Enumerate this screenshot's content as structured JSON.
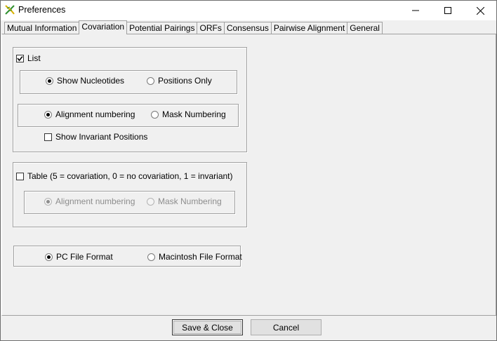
{
  "window": {
    "title": "Preferences"
  },
  "tabs": [
    {
      "label": "Mutual Information"
    },
    {
      "label": "Covariation",
      "active": true
    },
    {
      "label": "Potential Pairings"
    },
    {
      "label": "ORFs"
    },
    {
      "label": "Consensus"
    },
    {
      "label": "Pairwise Alignment"
    },
    {
      "label": "General"
    }
  ],
  "list_group": {
    "list_label": "List",
    "list_checked": true,
    "show_nucleotides": "Show Nucleotides",
    "positions_only": "Positions Only",
    "alignment_numbering": "Alignment numbering",
    "mask_numbering": "Mask Numbering",
    "show_invariant": "Show Invariant Positions"
  },
  "table_group": {
    "table_label": "Table (5 = covariation, 0 = no covariation, 1 = invariant)",
    "alignment_numbering": "Alignment numbering",
    "mask_numbering": "Mask Numbering"
  },
  "format_group": {
    "pc_format": "PC File Format",
    "mac_format": "Macintosh File Format"
  },
  "buttons": {
    "save_close": "Save & Close",
    "cancel": "Cancel"
  },
  "icons": {
    "app": "dna-icon",
    "minimize": "minimize-icon",
    "maximize": "maximize-icon",
    "close": "close-icon"
  }
}
